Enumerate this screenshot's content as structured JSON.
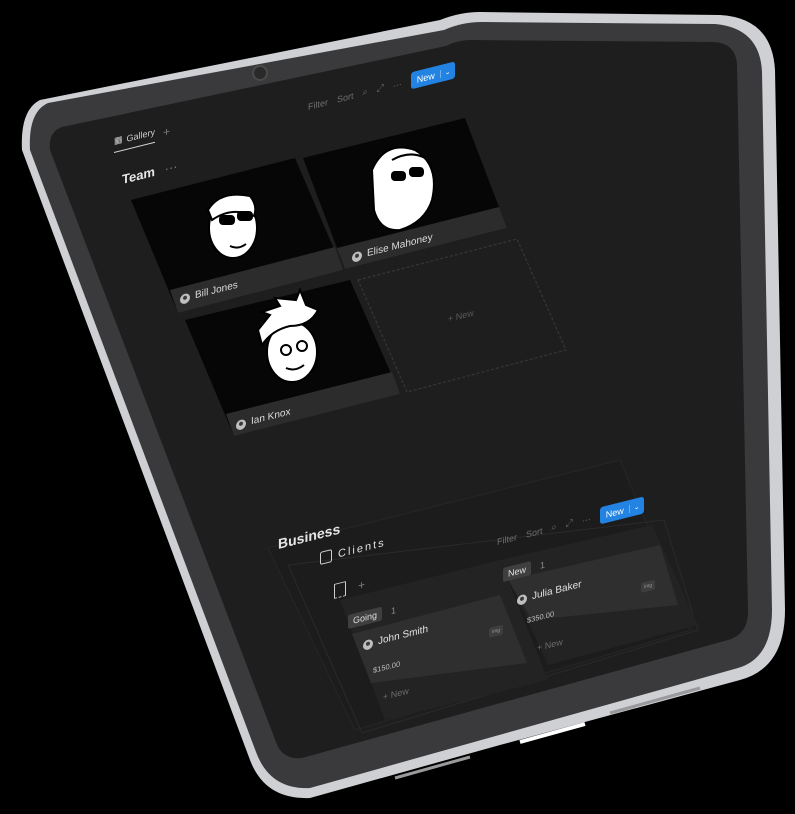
{
  "toolbar_top": {
    "filter_label": "Filter",
    "sort_label": "Sort",
    "more_label": "···",
    "new_label": "New",
    "caret": "⌄"
  },
  "gallery_tab": {
    "label": "Gallery",
    "add": "+"
  },
  "team": {
    "title": "Team",
    "more": "···",
    "cards": [
      {
        "name": "Bill Jones"
      },
      {
        "name": "Elise Mahoney"
      },
      {
        "name": "Ian Knox"
      }
    ],
    "new_card_label": "+ New"
  },
  "business": {
    "title": "Business",
    "toolbar": {
      "filter_label": "Filter",
      "sort_label": "Sort",
      "more_label": "···",
      "new_label": "New",
      "caret": "⌄"
    },
    "board_title": "Clients",
    "board_add": "+",
    "groups": [
      {
        "status": "Going",
        "count": "1",
        "card": {
          "name": "John Smith",
          "price": "$150.00",
          "badge": "img"
        },
        "new_label": "+ New"
      },
      {
        "status": "New",
        "count": "1",
        "card": {
          "name": "Julia Baker",
          "price": "$350.00",
          "badge": "img"
        },
        "new_label": "+ New"
      }
    ]
  },
  "colors": {
    "accent": "#2383e2",
    "screen_bg": "#1f1f1f",
    "bezel": "#3b3b3d",
    "frame": "#d6d6d8"
  }
}
